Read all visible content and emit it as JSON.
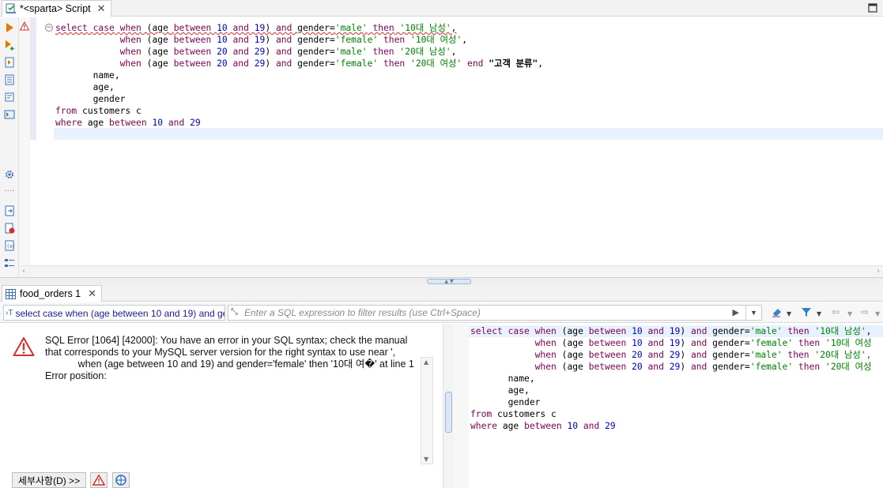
{
  "editor_tab": {
    "title": "*<sparta> Script",
    "close": "✕"
  },
  "editor": {
    "lines": [
      [
        {
          "t": "select",
          "c": "kw err"
        },
        {
          "t": " ",
          "c": "err"
        },
        {
          "t": "case",
          "c": "kw err"
        },
        {
          "t": " ",
          "c": "err"
        },
        {
          "t": "when",
          "c": "kw err"
        },
        {
          "t": " (age ",
          "c": "id err"
        },
        {
          "t": "between",
          "c": "kw err"
        },
        {
          "t": " ",
          "c": "err"
        },
        {
          "t": "10",
          "c": "num err"
        },
        {
          "t": " ",
          "c": "err"
        },
        {
          "t": "and",
          "c": "kw err"
        },
        {
          "t": " ",
          "c": "err"
        },
        {
          "t": "19",
          "c": "num err"
        },
        {
          "t": ") ",
          "c": "id err"
        },
        {
          "t": "and",
          "c": "kw err"
        },
        {
          "t": " gender=",
          "c": "id err"
        },
        {
          "t": "'male'",
          "c": "str err"
        },
        {
          "t": " ",
          "c": "err"
        },
        {
          "t": "then",
          "c": "kw err"
        },
        {
          "t": " ",
          "c": "err"
        },
        {
          "t": "'10대 남성'",
          "c": "str err"
        },
        {
          "t": ",",
          "c": "id err"
        }
      ],
      [
        {
          "t": "            ",
          "c": "id"
        },
        {
          "t": "when",
          "c": "kw"
        },
        {
          "t": " (age ",
          "c": "id"
        },
        {
          "t": "between",
          "c": "kw"
        },
        {
          "t": " ",
          "c": "id"
        },
        {
          "t": "10",
          "c": "num"
        },
        {
          "t": " ",
          "c": "id"
        },
        {
          "t": "and",
          "c": "kw"
        },
        {
          "t": " ",
          "c": "id"
        },
        {
          "t": "19",
          "c": "num"
        },
        {
          "t": ") ",
          "c": "id"
        },
        {
          "t": "and",
          "c": "kw"
        },
        {
          "t": " gender=",
          "c": "id"
        },
        {
          "t": "'female'",
          "c": "str"
        },
        {
          "t": " ",
          "c": "id"
        },
        {
          "t": "then",
          "c": "kw"
        },
        {
          "t": " ",
          "c": "id"
        },
        {
          "t": "'10대 여성'",
          "c": "str"
        },
        {
          "t": ",",
          "c": "id"
        }
      ],
      [
        {
          "t": "            ",
          "c": "id"
        },
        {
          "t": "when",
          "c": "kw"
        },
        {
          "t": " (age ",
          "c": "id"
        },
        {
          "t": "between",
          "c": "kw"
        },
        {
          "t": " ",
          "c": "id"
        },
        {
          "t": "20",
          "c": "num"
        },
        {
          "t": " ",
          "c": "id"
        },
        {
          "t": "and",
          "c": "kw"
        },
        {
          "t": " ",
          "c": "id"
        },
        {
          "t": "29",
          "c": "num"
        },
        {
          "t": ") ",
          "c": "id"
        },
        {
          "t": "and",
          "c": "kw"
        },
        {
          "t": " gender=",
          "c": "id"
        },
        {
          "t": "'male'",
          "c": "str"
        },
        {
          "t": " ",
          "c": "id"
        },
        {
          "t": "then",
          "c": "kw"
        },
        {
          "t": " ",
          "c": "id"
        },
        {
          "t": "'20대 남성'",
          "c": "str"
        },
        {
          "t": ",",
          "c": "id"
        }
      ],
      [
        {
          "t": "            ",
          "c": "id"
        },
        {
          "t": "when",
          "c": "kw"
        },
        {
          "t": " (age ",
          "c": "id"
        },
        {
          "t": "between",
          "c": "kw"
        },
        {
          "t": " ",
          "c": "id"
        },
        {
          "t": "20",
          "c": "num"
        },
        {
          "t": " ",
          "c": "id"
        },
        {
          "t": "and",
          "c": "kw"
        },
        {
          "t": " ",
          "c": "id"
        },
        {
          "t": "29",
          "c": "num"
        },
        {
          "t": ") ",
          "c": "id"
        },
        {
          "t": "and",
          "c": "kw"
        },
        {
          "t": " gender=",
          "c": "id"
        },
        {
          "t": "'female'",
          "c": "str"
        },
        {
          "t": " ",
          "c": "id"
        },
        {
          "t": "then",
          "c": "kw"
        },
        {
          "t": " ",
          "c": "id"
        },
        {
          "t": "'20대 여성'",
          "c": "str"
        },
        {
          "t": " ",
          "c": "id"
        },
        {
          "t": "end",
          "c": "kw"
        },
        {
          "t": " ",
          "c": "id"
        },
        {
          "t": "\"고객 분류\"",
          "c": "lbl"
        },
        {
          "t": ",",
          "c": "id"
        }
      ],
      [
        {
          "t": "       name,",
          "c": "id"
        }
      ],
      [
        {
          "t": "       age,",
          "c": "id"
        }
      ],
      [
        {
          "t": "       gender",
          "c": "id"
        }
      ],
      [
        {
          "t": "from",
          "c": "kw"
        },
        {
          "t": " customers c",
          "c": "id"
        }
      ],
      [
        {
          "t": "where",
          "c": "kw"
        },
        {
          "t": " age ",
          "c": "id"
        },
        {
          "t": "between",
          "c": "kw"
        },
        {
          "t": " ",
          "c": "id"
        },
        {
          "t": "10",
          "c": "num"
        },
        {
          "t": " ",
          "c": "id"
        },
        {
          "t": "and",
          "c": "kw"
        },
        {
          "t": " ",
          "c": "id"
        },
        {
          "t": "29",
          "c": "num"
        }
      ]
    ]
  },
  "result_tab": {
    "title": "food_orders 1",
    "close": "✕"
  },
  "filter_bar": {
    "query_text": "select case when (age between 10 and 19) and gender='male' then '10대 남성',",
    "filter_placeholder": "Enter a SQL expression to filter results (use Ctrl+Space)"
  },
  "error": {
    "message": "SQL Error [1064] [42000]: You have an error in your SQL syntax; check the manual\nthat corresponds to your MySQL server version for the right syntax to use near ',\n            when (age between 10 and 19) and gender='female' then '10대 여�' at line 1\nError position:",
    "details_label": "세부사항(D) >>"
  },
  "sql_panel": {
    "lines": [
      [
        {
          "t": "select",
          "c": "kw"
        },
        {
          "t": " ",
          "c": "id"
        },
        {
          "t": "case",
          "c": "kw"
        },
        {
          "t": " ",
          "c": "id"
        },
        {
          "t": "when",
          "c": "kw"
        },
        {
          "t": " (age ",
          "c": "id"
        },
        {
          "t": "between",
          "c": "kw"
        },
        {
          "t": " ",
          "c": "id"
        },
        {
          "t": "10",
          "c": "num"
        },
        {
          "t": " ",
          "c": "id"
        },
        {
          "t": "and",
          "c": "kw"
        },
        {
          "t": " ",
          "c": "id"
        },
        {
          "t": "19",
          "c": "num"
        },
        {
          "t": ") ",
          "c": "id"
        },
        {
          "t": "and",
          "c": "kw"
        },
        {
          "t": " gender=",
          "c": "id"
        },
        {
          "t": "'male'",
          "c": "str"
        },
        {
          "t": " ",
          "c": "id"
        },
        {
          "t": "then",
          "c": "kw"
        },
        {
          "t": " ",
          "c": "id"
        },
        {
          "t": "'10대 남성'",
          "c": "str"
        },
        {
          "t": ",",
          "c": "id"
        }
      ],
      [
        {
          "t": "            ",
          "c": "id"
        },
        {
          "t": "when",
          "c": "kw"
        },
        {
          "t": " (age ",
          "c": "id"
        },
        {
          "t": "between",
          "c": "kw"
        },
        {
          "t": " ",
          "c": "id"
        },
        {
          "t": "10",
          "c": "num"
        },
        {
          "t": " ",
          "c": "id"
        },
        {
          "t": "and",
          "c": "kw"
        },
        {
          "t": " ",
          "c": "id"
        },
        {
          "t": "19",
          "c": "num"
        },
        {
          "t": ") ",
          "c": "id"
        },
        {
          "t": "and",
          "c": "kw"
        },
        {
          "t": " gender=",
          "c": "id"
        },
        {
          "t": "'female'",
          "c": "str"
        },
        {
          "t": " ",
          "c": "id"
        },
        {
          "t": "then",
          "c": "kw"
        },
        {
          "t": " ",
          "c": "id"
        },
        {
          "t": "'10대 여성",
          "c": "str"
        }
      ],
      [
        {
          "t": "            ",
          "c": "id"
        },
        {
          "t": "when",
          "c": "kw"
        },
        {
          "t": " (age ",
          "c": "id"
        },
        {
          "t": "between",
          "c": "kw"
        },
        {
          "t": " ",
          "c": "id"
        },
        {
          "t": "20",
          "c": "num"
        },
        {
          "t": " ",
          "c": "id"
        },
        {
          "t": "and",
          "c": "kw"
        },
        {
          "t": " ",
          "c": "id"
        },
        {
          "t": "29",
          "c": "num"
        },
        {
          "t": ") ",
          "c": "id"
        },
        {
          "t": "and",
          "c": "kw"
        },
        {
          "t": " gender=",
          "c": "id"
        },
        {
          "t": "'male'",
          "c": "str"
        },
        {
          "t": " ",
          "c": "id"
        },
        {
          "t": "then",
          "c": "kw"
        },
        {
          "t": " ",
          "c": "id"
        },
        {
          "t": "'20대 남성',",
          "c": "str"
        }
      ],
      [
        {
          "t": "            ",
          "c": "id"
        },
        {
          "t": "when",
          "c": "kw"
        },
        {
          "t": " (age ",
          "c": "id"
        },
        {
          "t": "between",
          "c": "kw"
        },
        {
          "t": " ",
          "c": "id"
        },
        {
          "t": "20",
          "c": "num"
        },
        {
          "t": " ",
          "c": "id"
        },
        {
          "t": "and",
          "c": "kw"
        },
        {
          "t": " ",
          "c": "id"
        },
        {
          "t": "29",
          "c": "num"
        },
        {
          "t": ") ",
          "c": "id"
        },
        {
          "t": "and",
          "c": "kw"
        },
        {
          "t": " gender=",
          "c": "id"
        },
        {
          "t": "'female'",
          "c": "str"
        },
        {
          "t": " ",
          "c": "id"
        },
        {
          "t": "then",
          "c": "kw"
        },
        {
          "t": " ",
          "c": "id"
        },
        {
          "t": "'20대 여성",
          "c": "str"
        }
      ],
      [
        {
          "t": "       name,",
          "c": "id"
        }
      ],
      [
        {
          "t": "       age,",
          "c": "id"
        }
      ],
      [
        {
          "t": "       gender",
          "c": "id"
        }
      ],
      [
        {
          "t": "from",
          "c": "kw"
        },
        {
          "t": " customers c",
          "c": "id"
        }
      ],
      [
        {
          "t": "where",
          "c": "kw"
        },
        {
          "t": " age ",
          "c": "id"
        },
        {
          "t": "between",
          "c": "kw"
        },
        {
          "t": " ",
          "c": "id"
        },
        {
          "t": "10",
          "c": "num"
        },
        {
          "t": " ",
          "c": "id"
        },
        {
          "t": "and",
          "c": "kw"
        },
        {
          "t": " ",
          "c": "id"
        },
        {
          "t": "29",
          "c": "num"
        }
      ]
    ]
  },
  "colors": {
    "keyword": "#7f0055",
    "number": "#0000c0",
    "string": "#008000",
    "current_line": "#e8f2fe",
    "error_red": "#d03030"
  }
}
